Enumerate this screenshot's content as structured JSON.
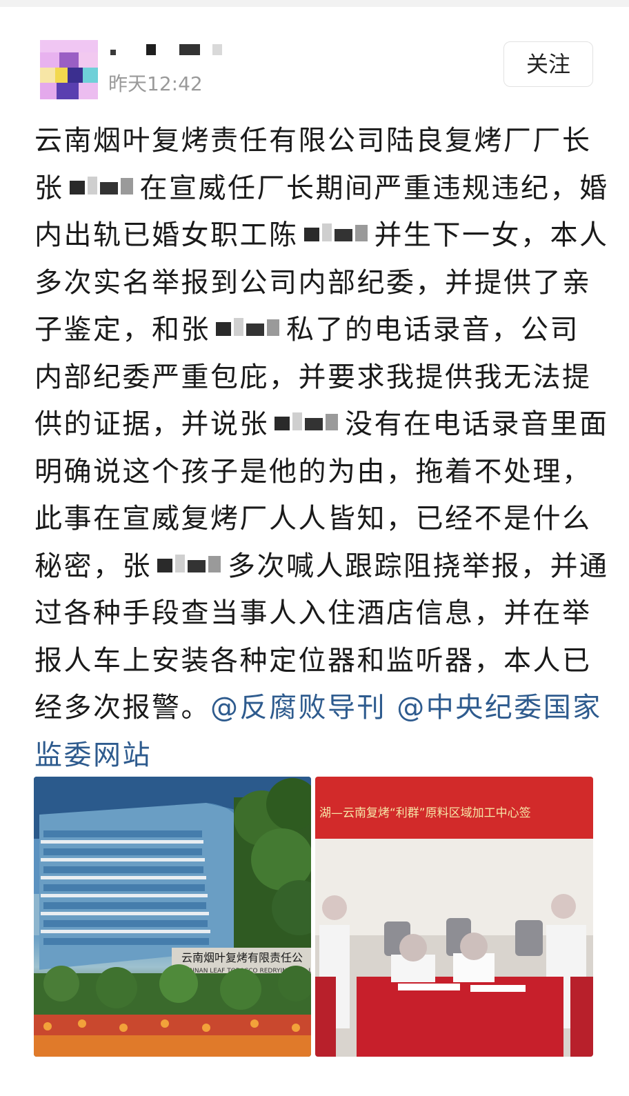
{
  "post": {
    "author": {
      "name": "",
      "avatar_icon": "mosaic-avatar-icon"
    },
    "timestamp": "昨天12:42",
    "follow_label": "关注",
    "lines": [
      {
        "segments": [
          {
            "text": "云南烟叶复烤责任有限公司陆良复烤厂厂长"
          }
        ]
      },
      {
        "segments": [
          {
            "text": "张"
          },
          {
            "redacted": true
          },
          {
            "text": "在宣威任厂长期间严重违规违纪，婚"
          }
        ]
      },
      {
        "segments": [
          {
            "text": "内出轨已婚女职工陈"
          },
          {
            "redacted": true
          },
          {
            "text": "并生下一女，本人"
          }
        ]
      },
      {
        "segments": [
          {
            "text": "多次实名举报到公司内部纪委，并提供了亲"
          }
        ]
      },
      {
        "segments": [
          {
            "text": "子鉴定，和张"
          },
          {
            "redacted": true
          },
          {
            "text": "私了的电话录音，公司"
          }
        ]
      },
      {
        "segments": [
          {
            "text": "内部纪委严重包庇，并要求我提供我无法提"
          }
        ]
      },
      {
        "segments": [
          {
            "text": "供的证据，并说张"
          },
          {
            "redacted": true
          },
          {
            "text": "没有在电话录音里面"
          }
        ]
      },
      {
        "segments": [
          {
            "text": "明确说这个孩子是他的为由，拖着不处理，"
          }
        ]
      },
      {
        "segments": [
          {
            "text": "此事在宣威复烤厂人人皆知，已经不是什么"
          }
        ]
      },
      {
        "segments": [
          {
            "text": "秘密，张"
          },
          {
            "redacted": true
          },
          {
            "text": "多次喊人跟踪阻挠举报，并通"
          }
        ]
      },
      {
        "segments": [
          {
            "text": "过各种手段查当事人入住酒店信息，并在举"
          }
        ]
      },
      {
        "segments": [
          {
            "text": "报人车上安装各种定位器和监听器，本人已"
          }
        ]
      },
      {
        "segments": [
          {
            "text": "经多次报警。"
          },
          {
            "text": "@反腐败导刊 @中央纪委国家",
            "mention": true
          }
        ]
      },
      {
        "segments": [
          {
            "text": "监委网站",
            "mention": true
          }
        ]
      }
    ],
    "images": [
      {
        "sign_main": "云南烟叶复烤有限责任公",
        "sign_sub": "YUNNAN LEAF TOBACCO REDRYING CO., L"
      },
      {
        "banner": "湖—云南复烤“利群”原料区域加工中心签"
      }
    ],
    "colors": {
      "text": "#1a1a1a",
      "mention": "#2e5b8e",
      "meta": "#9a9a9a",
      "background": "#ffffff"
    }
  }
}
